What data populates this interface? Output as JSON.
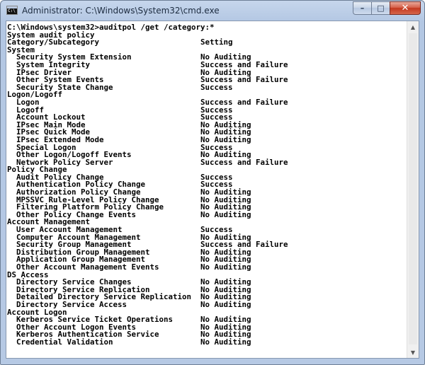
{
  "window": {
    "title": "Administrator: C:\\Windows\\System32\\cmd.exe",
    "icon": "cmd-icon",
    "icon_text": "C:\\",
    "buttons": {
      "minimize": "–",
      "maximize": "□",
      "close": "✕"
    }
  },
  "console": {
    "lines": [
      "C:\\Windows\\system32>auditpol /get /category:*",
      "System audit policy",
      "Category/Subcategory                      Setting",
      "System",
      "  Security System Extension               No Auditing",
      "  System Integrity                        Success and Failure",
      "  IPsec Driver                            No Auditing",
      "  Other System Events                     Success and Failure",
      "  Security State Change                   Success",
      "Logon/Logoff",
      "  Logon                                   Success and Failure",
      "  Logoff                                  Success",
      "  Account Lockout                         Success",
      "  IPsec Main Mode                         No Auditing",
      "  IPsec Quick Mode                        No Auditing",
      "  IPsec Extended Mode                     No Auditing",
      "  Special Logon                           Success",
      "  Other Logon/Logoff Events               No Auditing",
      "  Network Policy Server                   Success and Failure",
      "Policy Change",
      "  Audit Policy Change                     Success",
      "  Authentication Policy Change            Success",
      "  Authorization Policy Change             No Auditing",
      "  MPSSVC Rule-Level Policy Change         No Auditing",
      "  Filtering Platform Policy Change        No Auditing",
      "  Other Policy Change Events              No Auditing",
      "Account Management",
      "  User Account Management                 Success",
      "  Computer Account Management             No Auditing",
      "  Security Group Management               Success and Failure",
      "  Distribution Group Management           No Auditing",
      "  Application Group Management            No Auditing",
      "  Other Account Management Events         No Auditing",
      "DS Access",
      "  Directory Service Changes               No Auditing",
      "  Directory Service Replication           No Auditing",
      "  Detailed Directory Service Replication  No Auditing",
      "  Directory Service Access                No Auditing",
      "Account Logon",
      "  Kerberos Service Ticket Operations      No Auditing",
      "  Other Account Logon Events              No Auditing",
      "  Kerberos Authentication Service         No Auditing",
      "  Credential Validation                   No Auditing"
    ]
  },
  "scrollbar": {
    "up_arrow": "▲",
    "down_arrow": "▼",
    "thumb_position": 0.0
  }
}
